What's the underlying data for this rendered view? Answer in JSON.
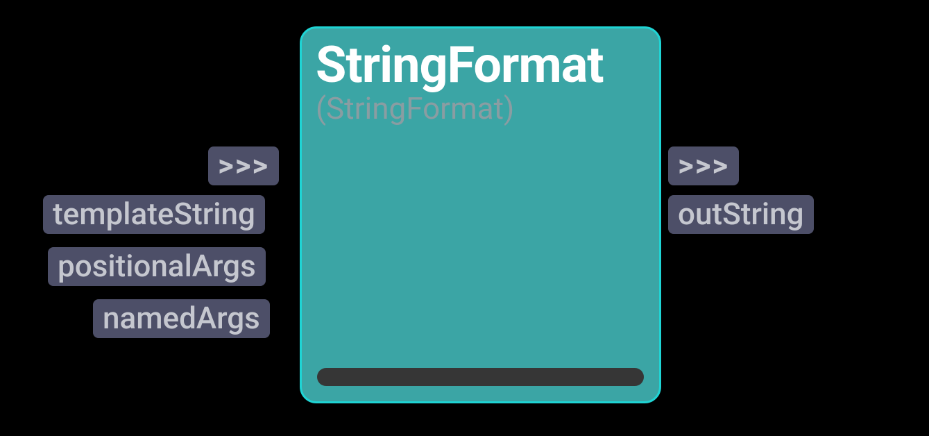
{
  "node": {
    "title": "StringFormat",
    "subtitle": "(StringFormat)"
  },
  "inputs": {
    "flow": ">>>",
    "templateString": "templateString",
    "positionalArgs": "positionalArgs",
    "namedArgs": "namedArgs"
  },
  "outputs": {
    "flow": ">>>",
    "outString": "outString"
  }
}
